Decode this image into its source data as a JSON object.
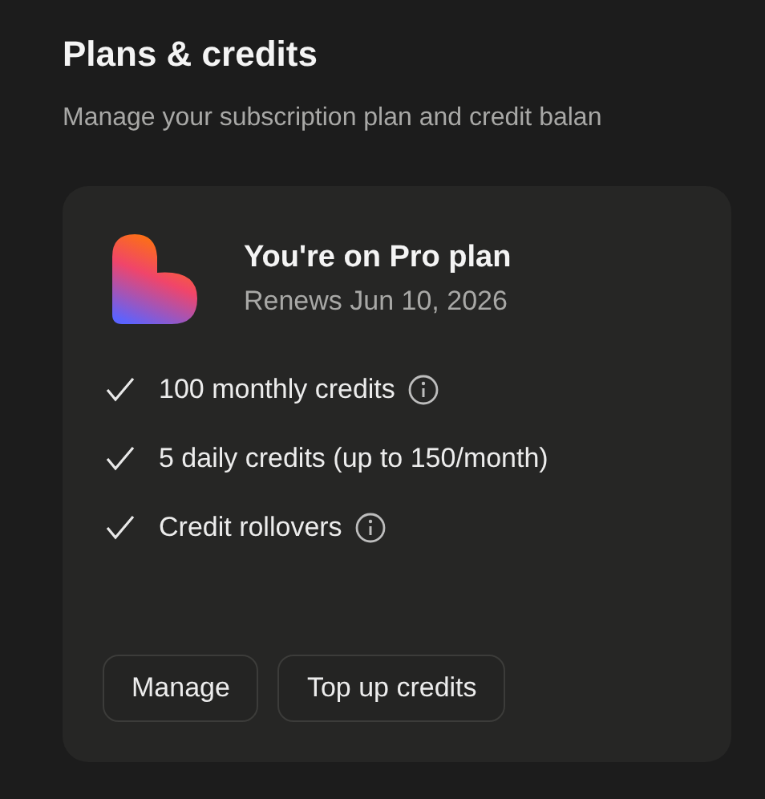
{
  "header": {
    "title": "Plans & credits",
    "subtitle": "Manage your subscription plan and credit balan"
  },
  "plan_card": {
    "title": "You're on Pro plan",
    "renewal": "Renews Jun 10, 2026",
    "features": [
      {
        "text": "100 monthly credits",
        "info": true
      },
      {
        "text": "5 daily credits (up to 150/month)",
        "info": false
      },
      {
        "text": "Credit rollovers",
        "info": true
      }
    ],
    "buttons": [
      "Manage",
      "Top up credits"
    ]
  }
}
